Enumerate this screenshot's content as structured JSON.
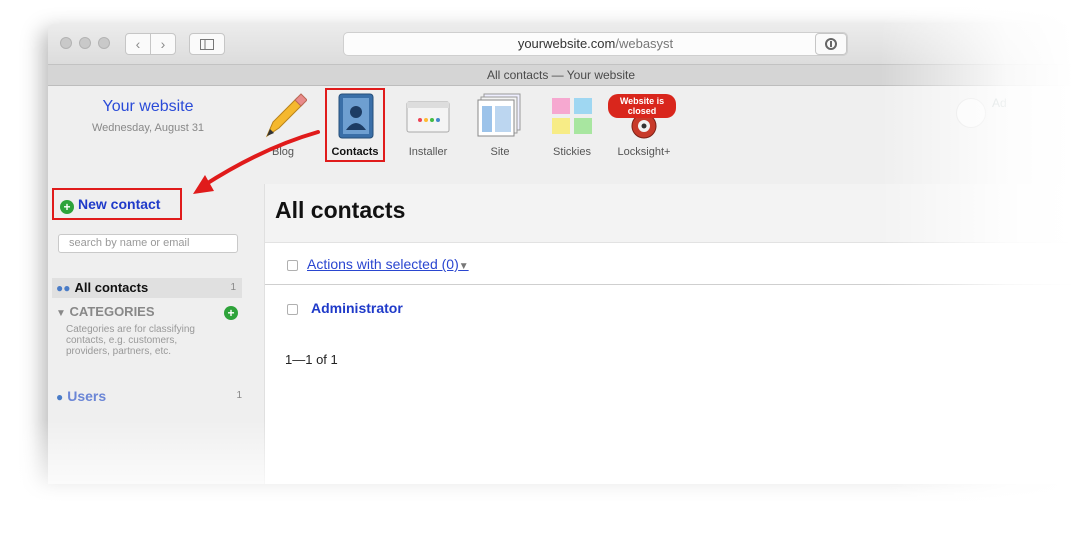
{
  "browser": {
    "url_domain": "yourwebsite.com",
    "url_path": "/webasyst",
    "tab_title": "All contacts — Your website",
    "back_glyph": "‹",
    "forward_glyph": "›",
    "reload_glyph": "↻"
  },
  "header": {
    "site_name": "Your website",
    "date": "Wednesday, August 31",
    "apps": [
      {
        "label": "Blog",
        "icon": "pencil-icon"
      },
      {
        "label": "Contacts",
        "icon": "address-book-icon",
        "selected": true
      },
      {
        "label": "Installer",
        "icon": "installer-box-icon"
      },
      {
        "label": "Site",
        "icon": "site-pages-icon"
      },
      {
        "label": "Stickies",
        "icon": "sticky-notes-icon"
      },
      {
        "label": "Locksight+",
        "icon": "lock-sight-icon"
      }
    ],
    "locksight_badge": {
      "line1": "Website is",
      "line2": "closed"
    },
    "user_label": "Ad"
  },
  "sidebar": {
    "new_contact": "New contact",
    "search_placeholder": "search by name or email",
    "all_contacts": {
      "label": "All contacts",
      "count": "1"
    },
    "categories": {
      "title": "CATEGORIES",
      "description": "Categories are for classifying contacts, e.g. customers, providers, partners, etc."
    },
    "users": {
      "label": "Users",
      "count": "1"
    }
  },
  "main": {
    "title": "All contacts",
    "actions_label": "Actions with selected (0)",
    "rows": [
      {
        "name": "Administrator"
      }
    ],
    "pagination": "1—1 of 1"
  },
  "colors": {
    "highlight_red": "#e01b1b",
    "link_blue": "#1f3ac9",
    "add_green": "#2ea33a"
  }
}
